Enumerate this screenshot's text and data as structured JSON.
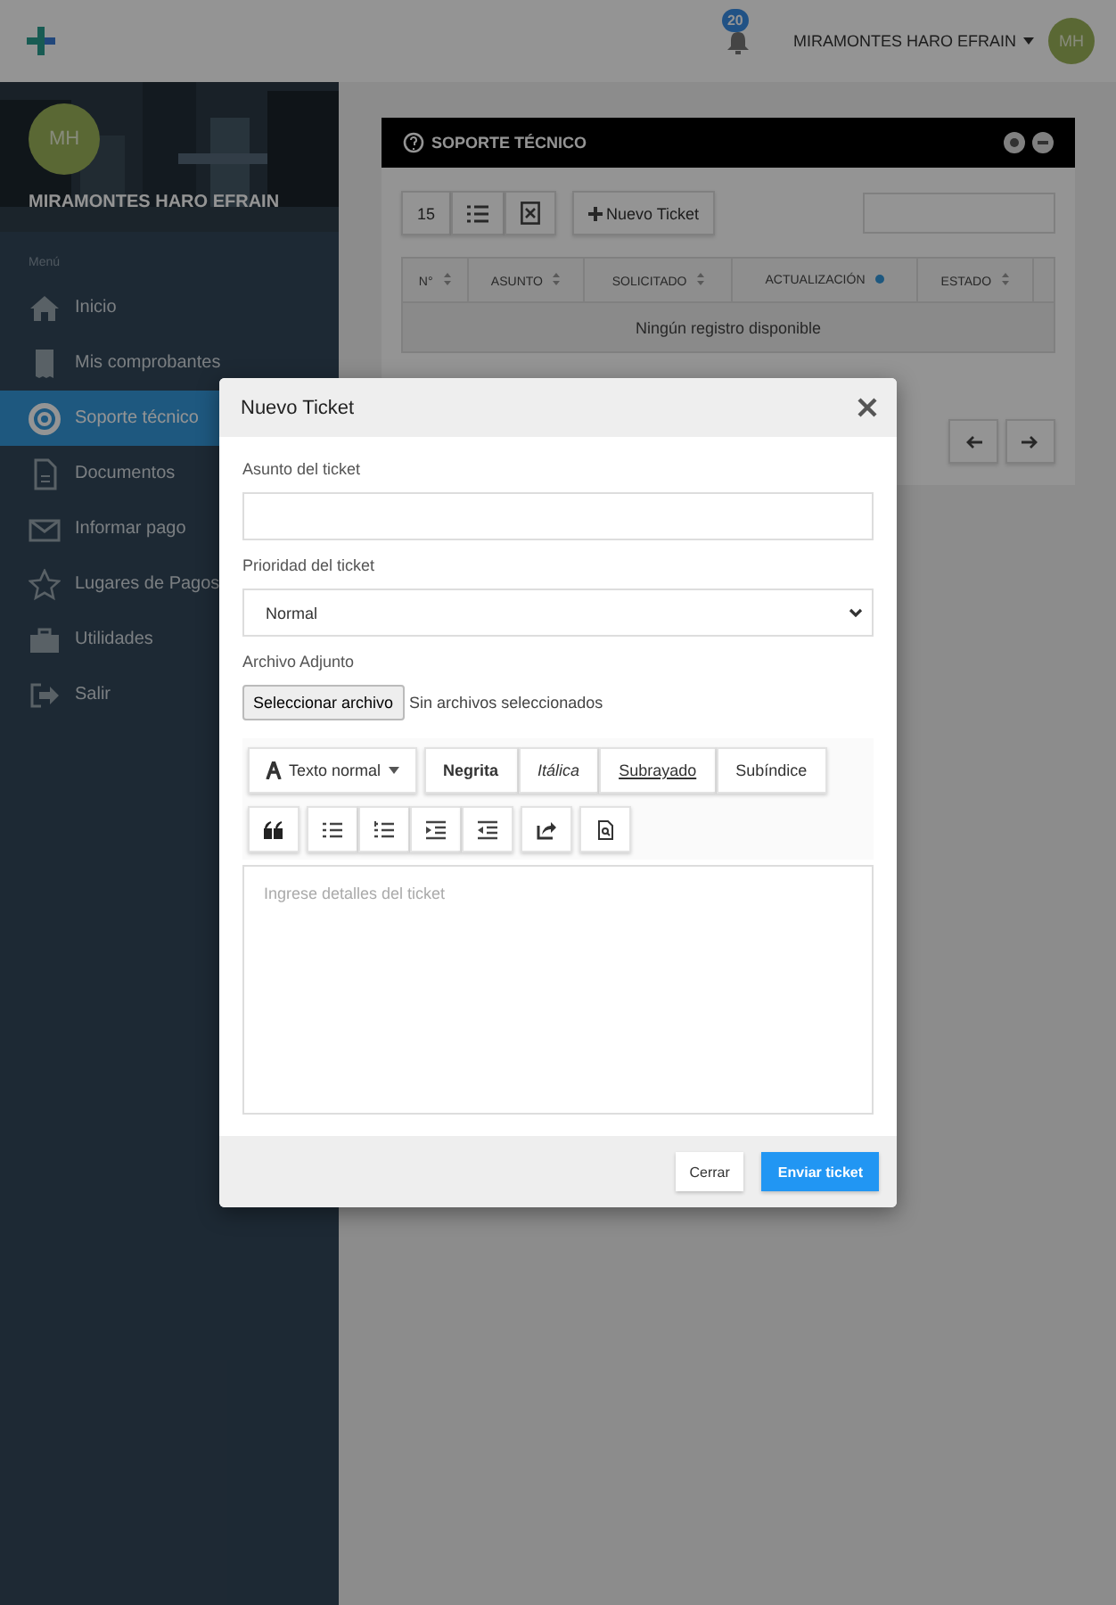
{
  "topbar": {
    "notification_count": "20",
    "user_name": "MIRAMONTES HARO EFRAIN",
    "avatar_initials": "MH"
  },
  "sidebar": {
    "profile": {
      "initials": "MH",
      "name": "MIRAMONTES HARO EFRAIN"
    },
    "section_label": "Menú",
    "items": [
      {
        "label": "Inicio",
        "selected": false
      },
      {
        "label": "Mis comprobantes",
        "selected": false
      },
      {
        "label": "Soporte técnico",
        "selected": true
      },
      {
        "label": "Documentos",
        "selected": false
      },
      {
        "label": "Informar pago",
        "selected": false
      },
      {
        "label": "Lugares de Pagos",
        "selected": false
      },
      {
        "label": "Utilidades",
        "selected": false
      },
      {
        "label": "Salir",
        "selected": false
      }
    ]
  },
  "panel": {
    "title": "SOPORTE TÉCNICO",
    "page_size": "15",
    "new_button": "Nuevo Ticket",
    "table": {
      "columns": [
        {
          "label": "N°",
          "sorted": false
        },
        {
          "label": "ASUNTO",
          "sorted": false
        },
        {
          "label": "SOLICITADO",
          "sorted": false
        },
        {
          "label": "ACTUALIZACIÓN",
          "sorted": true
        },
        {
          "label": "ESTADO",
          "sorted": false
        }
      ],
      "empty_message": "Ningún registro disponible"
    }
  },
  "modal": {
    "title": "Nuevo Ticket",
    "subject_label": "Asunto del ticket",
    "priority_label": "Prioridad del ticket",
    "priority_value": "Normal",
    "attachment_label": "Archivo Adjunto",
    "file_button": "Seleccionar archivo",
    "file_status": "Sin archivos seleccionados",
    "editor": {
      "style_dropdown": "Texto normal",
      "format_buttons": [
        {
          "label": "Negrita",
          "kind": "bold"
        },
        {
          "label": "Itálica",
          "kind": "italic"
        },
        {
          "label": "Subrayado",
          "kind": "underline"
        },
        {
          "label": "Subíndice",
          "kind": "plain"
        }
      ],
      "placeholder": "Ingrese detalles del ticket"
    },
    "buttons": [
      {
        "label": "Cerrar",
        "kind": "secondary"
      },
      {
        "label": "Enviar ticket",
        "kind": "primary"
      }
    ]
  }
}
